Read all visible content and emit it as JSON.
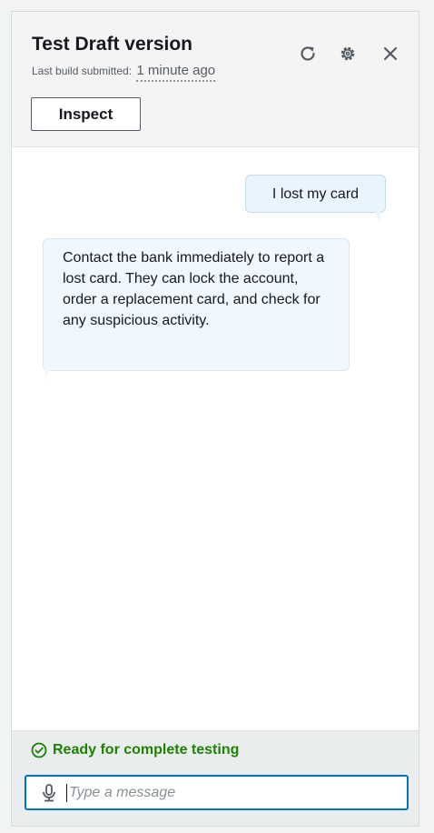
{
  "header": {
    "title": "Test Draft version",
    "subtitle_label": "Last build submitted:",
    "subtitle_time": "1 minute ago",
    "inspect_label": "Inspect",
    "icons": [
      "refresh-icon",
      "gear-icon",
      "close-icon"
    ]
  },
  "conversation": {
    "messages": [
      {
        "role": "user",
        "text": "I lost my card"
      },
      {
        "role": "bot",
        "text": "Contact the bank immediately to report a lost card. They can lock the account, order a replacement card, and check for any suspicious activity."
      }
    ]
  },
  "footer": {
    "status_text": "Ready for complete testing",
    "status_color": "#1d8102",
    "input_value": "",
    "input_placeholder": "Type a message",
    "input_border_color": "#0073bb",
    "icons": [
      "check-circle-icon",
      "microphone-icon"
    ]
  }
}
